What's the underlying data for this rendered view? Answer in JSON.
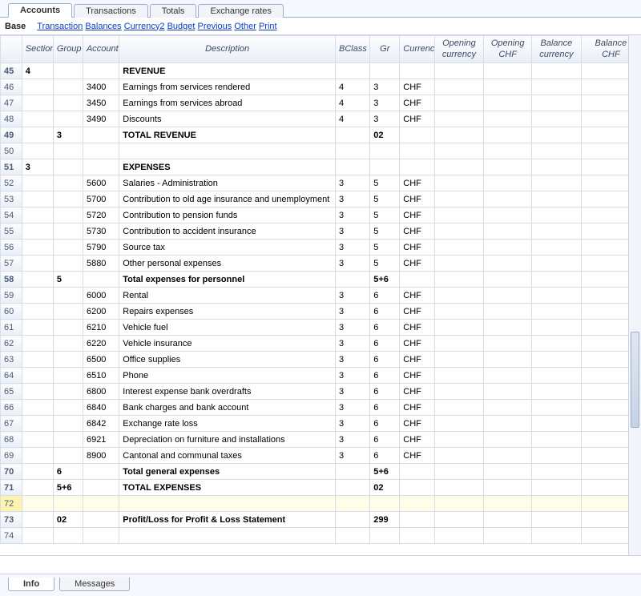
{
  "top_tabs": [
    "Accounts",
    "Transactions",
    "Totals",
    "Exchange rates"
  ],
  "active_top_tab": 0,
  "link_bar": {
    "base": "Base",
    "links": [
      "Transaction",
      "Balances",
      "Currency2",
      "Budget",
      "Previous",
      "Other",
      "Print"
    ]
  },
  "columns": [
    "",
    "Section",
    "Group",
    "Account",
    "Description",
    "BClass",
    "Gr",
    "Currency",
    "Opening currency",
    "Opening CHF",
    "Balance currency",
    "Balance CHF"
  ],
  "selected_row_index": 27,
  "rows": [
    {
      "n": 45,
      "section": "4",
      "group": "",
      "account": "",
      "desc": "REVENUE",
      "bclass": "",
      "gr": "",
      "curr": "",
      "bold": true
    },
    {
      "n": 46,
      "section": "",
      "group": "",
      "account": "3400",
      "desc": "Earnings from services rendered",
      "bclass": "4",
      "gr": "3",
      "curr": "CHF"
    },
    {
      "n": 47,
      "section": "",
      "group": "",
      "account": "3450",
      "desc": "Earnings from services abroad",
      "bclass": "4",
      "gr": "3",
      "curr": "CHF"
    },
    {
      "n": 48,
      "section": "",
      "group": "",
      "account": "3490",
      "desc": "Discounts",
      "bclass": "4",
      "gr": "3",
      "curr": "CHF"
    },
    {
      "n": 49,
      "section": "",
      "group": "3",
      "account": "",
      "desc": "TOTAL REVENUE",
      "bclass": "",
      "gr": "02",
      "curr": "",
      "bold": true
    },
    {
      "n": 50,
      "section": "",
      "group": "",
      "account": "",
      "desc": "",
      "bclass": "",
      "gr": "",
      "curr": ""
    },
    {
      "n": 51,
      "section": "3",
      "group": "",
      "account": "",
      "desc": "EXPENSES",
      "bclass": "",
      "gr": "",
      "curr": "",
      "bold": true
    },
    {
      "n": 52,
      "section": "",
      "group": "",
      "account": "5600",
      "desc": "Salaries - Administration",
      "bclass": "3",
      "gr": "5",
      "curr": "CHF"
    },
    {
      "n": 53,
      "section": "",
      "group": "",
      "account": "5700",
      "desc": "Contribution to old age insurance and unemployment",
      "bclass": "3",
      "gr": "5",
      "curr": "CHF"
    },
    {
      "n": 54,
      "section": "",
      "group": "",
      "account": "5720",
      "desc": "Contribution to pension funds",
      "bclass": "3",
      "gr": "5",
      "curr": "CHF"
    },
    {
      "n": 55,
      "section": "",
      "group": "",
      "account": "5730",
      "desc": "Contribution to accident insurance",
      "bclass": "3",
      "gr": "5",
      "curr": "CHF"
    },
    {
      "n": 56,
      "section": "",
      "group": "",
      "account": "5790",
      "desc": "Source tax",
      "bclass": "3",
      "gr": "5",
      "curr": "CHF"
    },
    {
      "n": 57,
      "section": "",
      "group": "",
      "account": "5880",
      "desc": "Other personal expenses",
      "bclass": "3",
      "gr": "5",
      "curr": "CHF"
    },
    {
      "n": 58,
      "section": "",
      "group": "5",
      "account": "",
      "desc": "Total expenses for personnel",
      "bclass": "",
      "gr": "5+6",
      "curr": "",
      "bold": true
    },
    {
      "n": 59,
      "section": "",
      "group": "",
      "account": "6000",
      "desc": "Rental",
      "bclass": "3",
      "gr": "6",
      "curr": "CHF"
    },
    {
      "n": 60,
      "section": "",
      "group": "",
      "account": "6200",
      "desc": "Repairs expenses",
      "bclass": "3",
      "gr": "6",
      "curr": "CHF"
    },
    {
      "n": 61,
      "section": "",
      "group": "",
      "account": "6210",
      "desc": "Vehicle fuel",
      "bclass": "3",
      "gr": "6",
      "curr": "CHF"
    },
    {
      "n": 62,
      "section": "",
      "group": "",
      "account": "6220",
      "desc": "Vehicle insurance",
      "bclass": "3",
      "gr": "6",
      "curr": "CHF"
    },
    {
      "n": 63,
      "section": "",
      "group": "",
      "account": "6500",
      "desc": "Office supplies",
      "bclass": "3",
      "gr": "6",
      "curr": "CHF"
    },
    {
      "n": 64,
      "section": "",
      "group": "",
      "account": "6510",
      "desc": "Phone",
      "bclass": "3",
      "gr": "6",
      "curr": "CHF"
    },
    {
      "n": 65,
      "section": "",
      "group": "",
      "account": "6800",
      "desc": "Interest expense bank overdrafts",
      "bclass": "3",
      "gr": "6",
      "curr": "CHF"
    },
    {
      "n": 66,
      "section": "",
      "group": "",
      "account": "6840",
      "desc": "Bank charges and bank account",
      "bclass": "3",
      "gr": "6",
      "curr": "CHF"
    },
    {
      "n": 67,
      "section": "",
      "group": "",
      "account": "6842",
      "desc": "Exchange rate loss",
      "bclass": "3",
      "gr": "6",
      "curr": "CHF"
    },
    {
      "n": 68,
      "section": "",
      "group": "",
      "account": "6921",
      "desc": "Depreciation on furniture and installations",
      "bclass": "3",
      "gr": "6",
      "curr": "CHF"
    },
    {
      "n": 69,
      "section": "",
      "group": "",
      "account": "8900",
      "desc": "Cantonal and communal taxes",
      "bclass": "3",
      "gr": "6",
      "curr": "CHF"
    },
    {
      "n": 70,
      "section": "",
      "group": "6",
      "account": "",
      "desc": "Total general expenses",
      "bclass": "",
      "gr": "5+6",
      "curr": "",
      "bold": true
    },
    {
      "n": 71,
      "section": "",
      "group": "5+6",
      "account": "",
      "desc": "TOTAL EXPENSES",
      "bclass": "",
      "gr": "02",
      "curr": "",
      "bold": true
    },
    {
      "n": 72,
      "section": "",
      "group": "",
      "account": "",
      "desc": "",
      "bclass": "",
      "gr": "",
      "curr": ""
    },
    {
      "n": 73,
      "section": "",
      "group": "02",
      "account": "",
      "desc": "Profit/Loss for Profit & Loss Statement",
      "bclass": "",
      "gr": "299",
      "curr": "",
      "bold": true
    },
    {
      "n": 74,
      "section": "",
      "group": "",
      "account": "",
      "desc": "",
      "bclass": "",
      "gr": "",
      "curr": ""
    }
  ],
  "bottom_tabs": [
    "Info",
    "Messages"
  ],
  "active_bottom_tab": 0
}
